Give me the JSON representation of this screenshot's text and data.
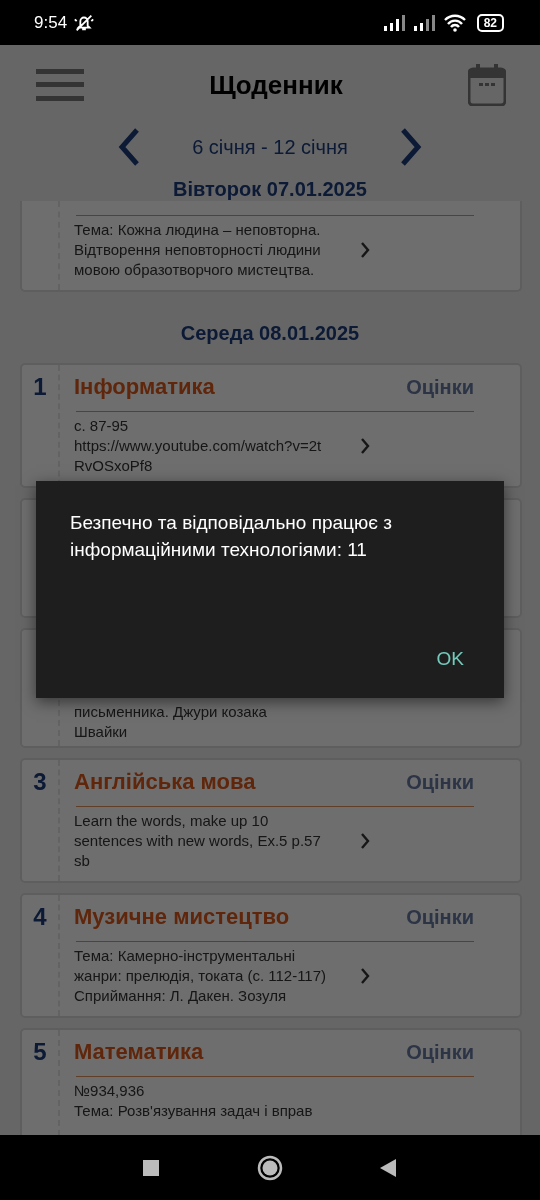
{
  "status_bar": {
    "time": "9:54",
    "battery": "82"
  },
  "header": {
    "title": "Щоденник"
  },
  "week_nav": {
    "range": "6 січня - 12 січня"
  },
  "days": [
    {
      "heading": "Вівторок 07.01.2025",
      "lessons": [
        {
          "kind": "top_cut",
          "body": [
            "Тема: Кожна людина – неповторна.",
            "Відтворення неповторності людини",
            "мовою образотворчого мистецтва."
          ]
        }
      ]
    },
    {
      "heading": "Середа 08.01.2025",
      "lessons": [
        {
          "kind": "full",
          "number": "1",
          "subject": "Інформатика",
          "grades": "Оцінки",
          "body": [
            "с. 87-95",
            "https://www.youtube.com/watch?v=2t",
            "RvOSxoPf8"
          ]
        },
        {
          "kind": "covered"
        },
        {
          "kind": "bottom_only",
          "body": [
            "письменника. Джури козака",
            "Швайки"
          ]
        },
        {
          "kind": "full",
          "number": "3",
          "subject": "Англійська мова",
          "grades": "Оцінки",
          "body": [
            "Learn the words,  make up 10",
            "sentences with new words, Ex.5 p.57",
            "sb"
          ]
        },
        {
          "kind": "full",
          "number": "4",
          "subject": "Музичне мистецтво",
          "grades": "Оцінки",
          "body": [
            "Тема: Камерно-інструментальні",
            "жанри: прелюдія, токата (с. 112-117)",
            "Сприймання: Л. Дакен. Зозуля"
          ]
        },
        {
          "kind": "bottom_cut",
          "number": "5",
          "subject": "Математика",
          "grades": "Оцінки",
          "body": [
            "№934,936",
            "Тема: Розв'язування задач і вправ"
          ]
        }
      ]
    }
  ],
  "dialog": {
    "message": "Безпечно та відповідально працює з інформаційними технологіями:  11",
    "button": "OK"
  }
}
